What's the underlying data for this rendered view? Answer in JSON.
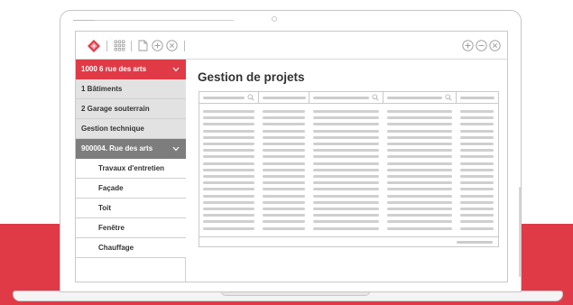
{
  "page": {
    "title": "Gestion de projets"
  },
  "toolbar": {
    "left_icons": [
      "app-logo-icon",
      "grid-apps-icon",
      "new-document-icon",
      "add-circle-icon",
      "close-circle-icon"
    ],
    "right_icons": [
      "add-circle-icon",
      "remove-circle-icon",
      "close-circle-icon"
    ]
  },
  "sidebar": {
    "items": [
      {
        "label": "1000 6 rue des arts",
        "style": "red",
        "chevron": true
      },
      {
        "label": "1 Bâtiments",
        "style": "gray"
      },
      {
        "label": "2 Garage souterrain",
        "style": "gray"
      },
      {
        "label": "Gestion technique",
        "style": "gray"
      },
      {
        "label": "900004. Rue des arts",
        "style": "dark",
        "chevron": true
      },
      {
        "label": "Travaux d'entretien",
        "style": "white",
        "sub": true
      },
      {
        "label": "Façade",
        "style": "white",
        "sub": true
      },
      {
        "label": "Toit",
        "style": "white",
        "sub": true
      },
      {
        "label": "Fenêtre",
        "style": "white",
        "sub": true
      },
      {
        "label": "Chauffage",
        "style": "white",
        "sub": true
      }
    ]
  },
  "table": {
    "column_count": 5,
    "searchable_columns": [
      0,
      2,
      3
    ],
    "placeholder_rows": 19
  },
  "colors": {
    "accent": "#e13a47",
    "nav_dark": "#7d7d7d",
    "nav_gray": "#e2e2e2",
    "placeholder": "#cfcfcf"
  }
}
